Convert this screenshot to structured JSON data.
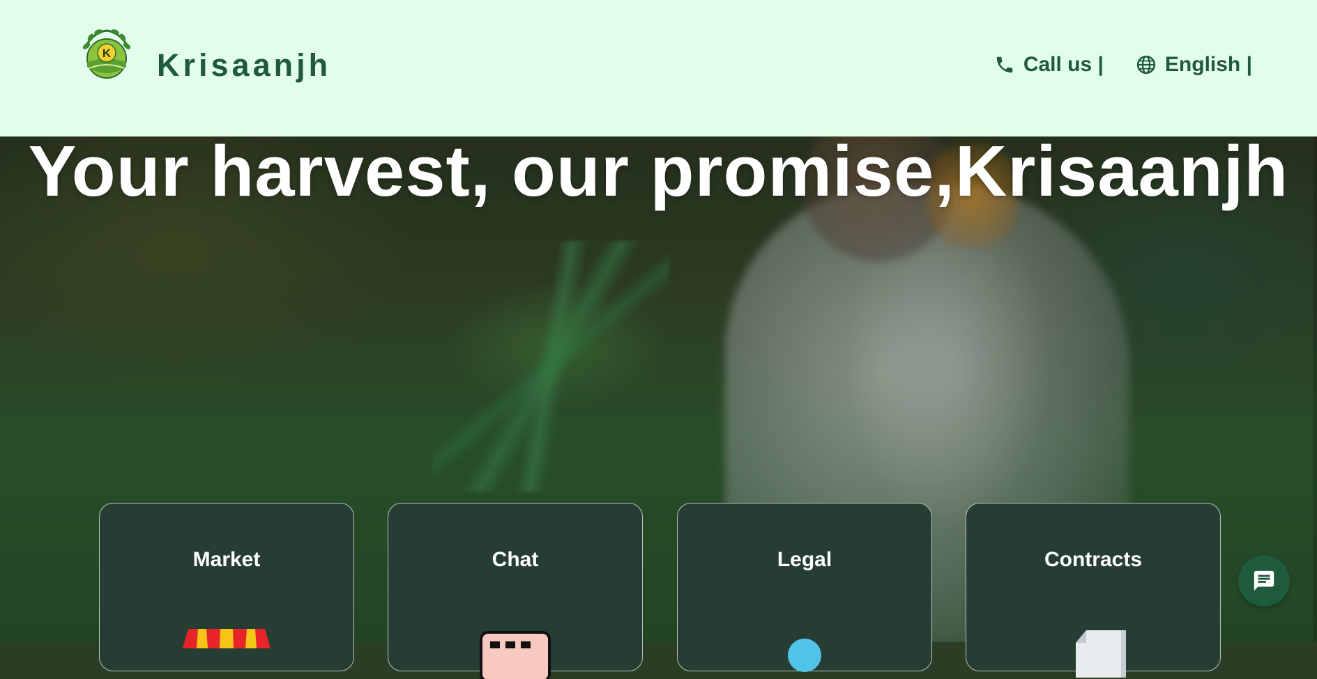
{
  "header": {
    "brand": "Krisaanjh",
    "logo_letter": "K",
    "nav": [
      {
        "label": "Call us |",
        "icon": "phone-icon"
      },
      {
        "label": "English |",
        "icon": "globe-icon"
      }
    ]
  },
  "hero": {
    "title": "Your harvest, our promise,Krisaanjh"
  },
  "cards": [
    {
      "title": "Market",
      "icon": "market-stall-icon"
    },
    {
      "title": "Chat",
      "icon": "chat-icon"
    },
    {
      "title": "Legal",
      "icon": "legal-icon"
    },
    {
      "title": "Contracts",
      "icon": "contract-document-icon"
    }
  ],
  "chat_fab": {
    "icon": "message-icon"
  },
  "colors": {
    "header_bg": "#e2fdec",
    "brand_green": "#1f5a3a",
    "card_bg": "#263d33",
    "fab_bg": "#1e5a3c"
  }
}
